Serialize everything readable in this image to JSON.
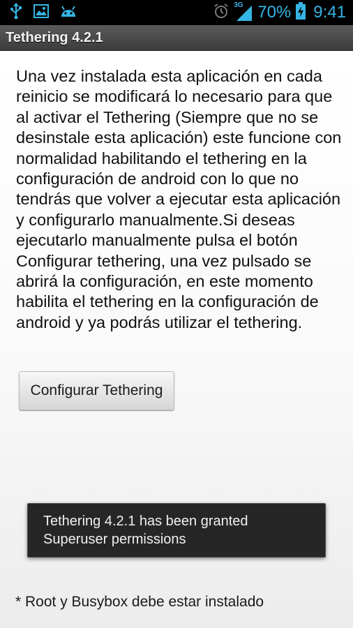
{
  "statusbar": {
    "left_icons": [
      "usb-icon",
      "image-icon",
      "android-icon"
    ],
    "right_icons": [
      "alarm-icon",
      "signal-3g-icon",
      "battery-charging-icon"
    ],
    "network": "3G",
    "battery_percent": "70%",
    "time": "9:41",
    "accent_color": "#35b5e5"
  },
  "titlebar": {
    "title": "Tethering 4.2.1"
  },
  "content": {
    "description": "Una vez instalada esta aplicación en cada reinicio se modificará lo necesario para que al activar el Tethering (Siempre que no se desinstale esta aplicación) este funcione con normalidad habilitando el tethering en la configuración de android con lo que no tendrás que volver a ejecutar esta aplicación y configurarlo manualmente.Si deseas ejecutarlo manualmente pulsa el botón Configurar tethering, una vez pulsado se abrirá la configuración, en este momento habilita el tethering en la configuración de android y ya podrás utilizar el tethering.",
    "button_label": "Configurar Tethering",
    "footnote": "* Root y Busybox debe estar instalado"
  },
  "toast": {
    "message": "Tethering 4.2.1 has been granted Superuser permissions"
  }
}
